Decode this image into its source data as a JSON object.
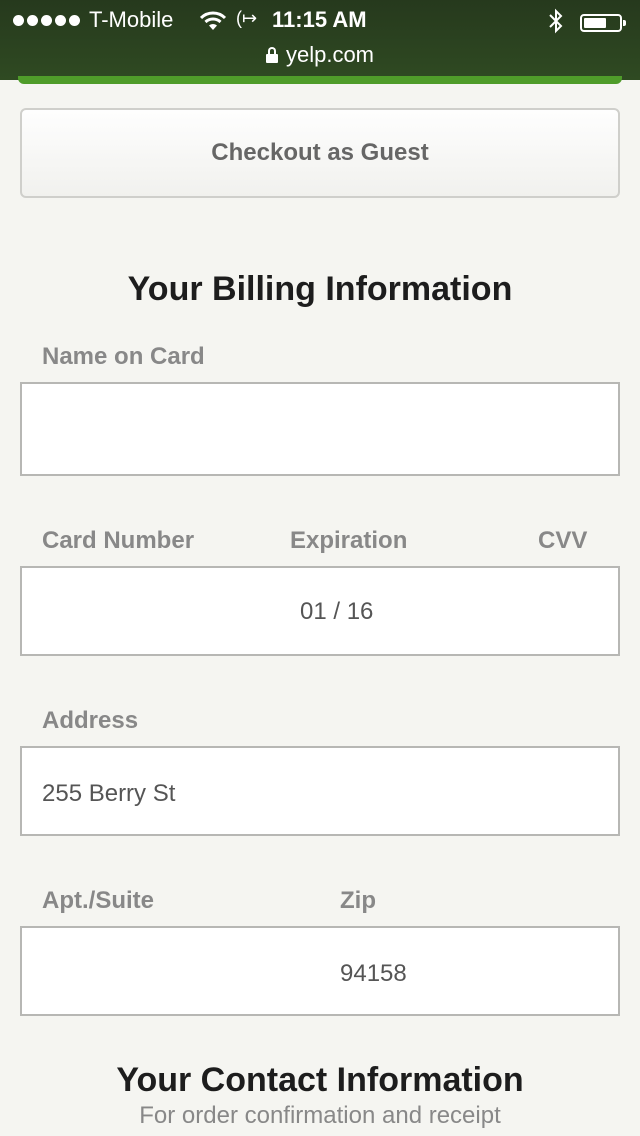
{
  "status_bar": {
    "carrier": "T-Mobile",
    "time": "11:15 AM",
    "url": "yelp.com"
  },
  "checkout": {
    "guest_button_label": "Checkout as Guest"
  },
  "billing": {
    "title": "Your Billing Information",
    "name_on_card_label": "Name on Card",
    "name_on_card_value": "",
    "card_number_label": "Card Number",
    "expiration_label": "Expiration",
    "cvv_label": "CVV",
    "expiration_value": "01 / 16",
    "address_label": "Address",
    "address_value": "255 Berry St",
    "apt_label": "Apt./Suite",
    "zip_label": "Zip",
    "zip_value": "94158"
  },
  "contact": {
    "title": "Your Contact Information",
    "subtitle": "For order confirmation and receipt"
  },
  "colors": {
    "status_bar": "#2f4a22",
    "accent_green": "#4f9c2a",
    "page_background": "#f5f5f1"
  },
  "icons": [
    "signal-dots-icon",
    "wifi-icon",
    "call-forward-icon",
    "bluetooth-icon",
    "battery-icon",
    "lock-icon"
  ]
}
